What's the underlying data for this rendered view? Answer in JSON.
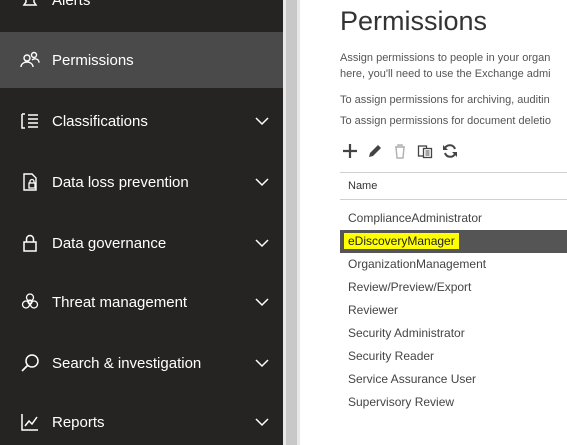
{
  "sidebar": {
    "items": [
      {
        "label": "Alerts",
        "icon": "alert-icon",
        "has_chevron": false
      },
      {
        "label": "Permissions",
        "icon": "people-icon",
        "has_chevron": false,
        "active": true
      },
      {
        "label": "Classifications",
        "icon": "list-icon",
        "has_chevron": true
      },
      {
        "label": "Data loss prevention",
        "icon": "lock-document-icon",
        "has_chevron": true
      },
      {
        "label": "Data governance",
        "icon": "lock-icon",
        "has_chevron": true
      },
      {
        "label": "Threat management",
        "icon": "biohazard-icon",
        "has_chevron": true
      },
      {
        "label": "Search & investigation",
        "icon": "search-icon",
        "has_chevron": true
      },
      {
        "label": "Reports",
        "icon": "chart-icon",
        "has_chevron": true
      }
    ]
  },
  "main": {
    "title": "Permissions",
    "description_lines": [
      "Assign permissions to people in your organ",
      "here, you'll need to use the Exchange admi",
      "To assign permissions for archiving, auditin",
      "To assign permissions for document deletio"
    ],
    "toolbar": [
      "add-icon",
      "edit-icon",
      "delete-icon",
      "copy-icon",
      "refresh-icon"
    ],
    "table": {
      "column_header": "Name",
      "rows": [
        "ComplianceAdministrator",
        "eDiscoveryManager",
        "OrganizationManagement",
        "Review/Preview/Export",
        "Reviewer",
        "Security Administrator",
        "Security Reader",
        "Service Assurance User",
        "Supervisory Review"
      ],
      "selected_index": 1
    }
  },
  "colors": {
    "sidebar_bg": "#252423",
    "sidebar_active": "#4a4a4a",
    "highlight": "#ffff00",
    "selected_row": "#555555"
  }
}
